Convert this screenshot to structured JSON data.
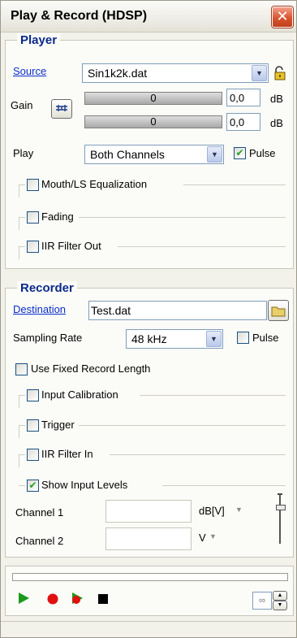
{
  "window": {
    "title": "Play & Record (HDSP)"
  },
  "player": {
    "heading": "Player",
    "source_label": "Source",
    "source_value": "Sin1k2k.dat",
    "gain_label": "Gain",
    "meter1_text": "0",
    "meter2_text": "0",
    "gain1_value": "0,0",
    "gain2_value": "0,0",
    "gain_unit1": "dB",
    "gain_unit2": "dB",
    "play_label": "Play",
    "play_value": "Both Channels",
    "pulse_label": "Pulse",
    "pulse_checked": true,
    "mouth_label": "Mouth/LS Equalization",
    "fading_label": "Fading",
    "iir_out_label": "IIR Filter Out"
  },
  "recorder": {
    "heading": "Recorder",
    "destination_label": "Destination",
    "destination_value": "Test.dat",
    "sampling_label": "Sampling Rate",
    "sampling_value": "48 kHz",
    "pulse_label": "Pulse",
    "fixed_length_label": "Use Fixed Record Length",
    "input_cal_label": "Input Calibration",
    "trigger_label": "Trigger",
    "iir_in_label": "IIR Filter In",
    "show_levels_label": "Show Input Levels",
    "show_levels_checked": true,
    "channel1_label": "Channel 1",
    "channel2_label": "Channel 2",
    "channel1_unit": "dB[V]",
    "channel2_unit": "V"
  },
  "transport": {
    "loop_symbol": "∞"
  },
  "colors": {
    "heading": "#0a2a8a",
    "link": "#0a2fc8",
    "play_green": "#1a9a1a",
    "record_red": "#e01010"
  }
}
